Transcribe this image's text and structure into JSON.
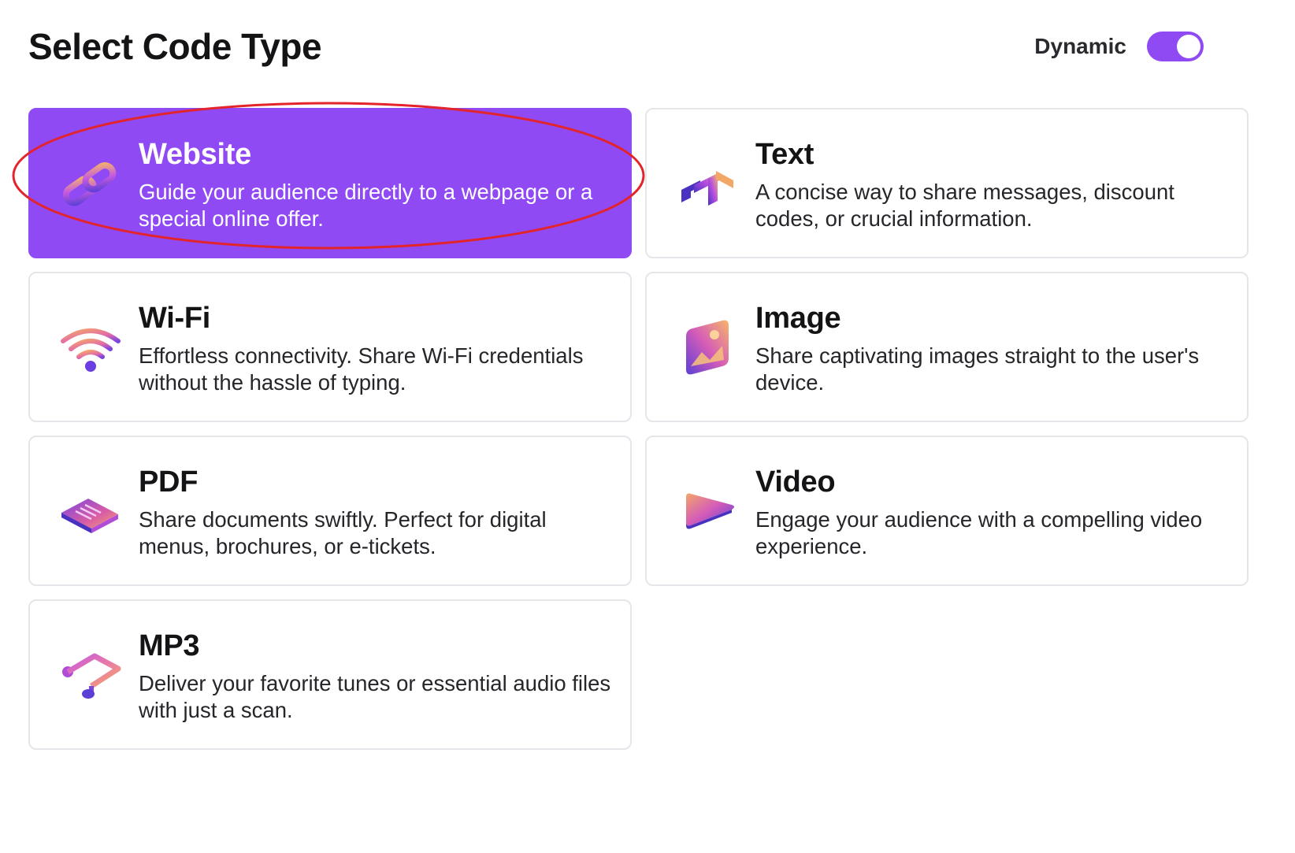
{
  "header": {
    "title": "Select Code Type",
    "dynamic_label": "Dynamic",
    "dynamic_enabled": true
  },
  "colors": {
    "accent": "#8f4af4",
    "annotation_ring": "#e3242b"
  },
  "code_types": [
    {
      "title": "Website",
      "description": "Guide your audience directly to a webpage or a special online offer.",
      "icon": "link-chain-icon",
      "selected": true
    },
    {
      "title": "Text",
      "description": "A concise way to share messages, discount codes, or crucial information.",
      "icon": "text-t-icon",
      "selected": false
    },
    {
      "title": "Wi-Fi",
      "description": "Effortless connectivity. Share Wi-Fi credentials without the hassle of typing.",
      "icon": "wifi-icon",
      "selected": false
    },
    {
      "title": "Image",
      "description": "Share captivating images straight to the user's device.",
      "icon": "image-icon",
      "selected": false
    },
    {
      "title": "PDF",
      "description": "Share documents swiftly. Perfect for digital menus, brochures, or e-tickets.",
      "icon": "document-icon",
      "selected": false
    },
    {
      "title": "Video",
      "description": "Engage your audience with a compelling video experience.",
      "icon": "play-icon",
      "selected": false
    },
    {
      "title": "MP3",
      "description": "Deliver your favorite tunes or essential audio files with just a scan.",
      "icon": "music-note-icon",
      "selected": false
    }
  ]
}
